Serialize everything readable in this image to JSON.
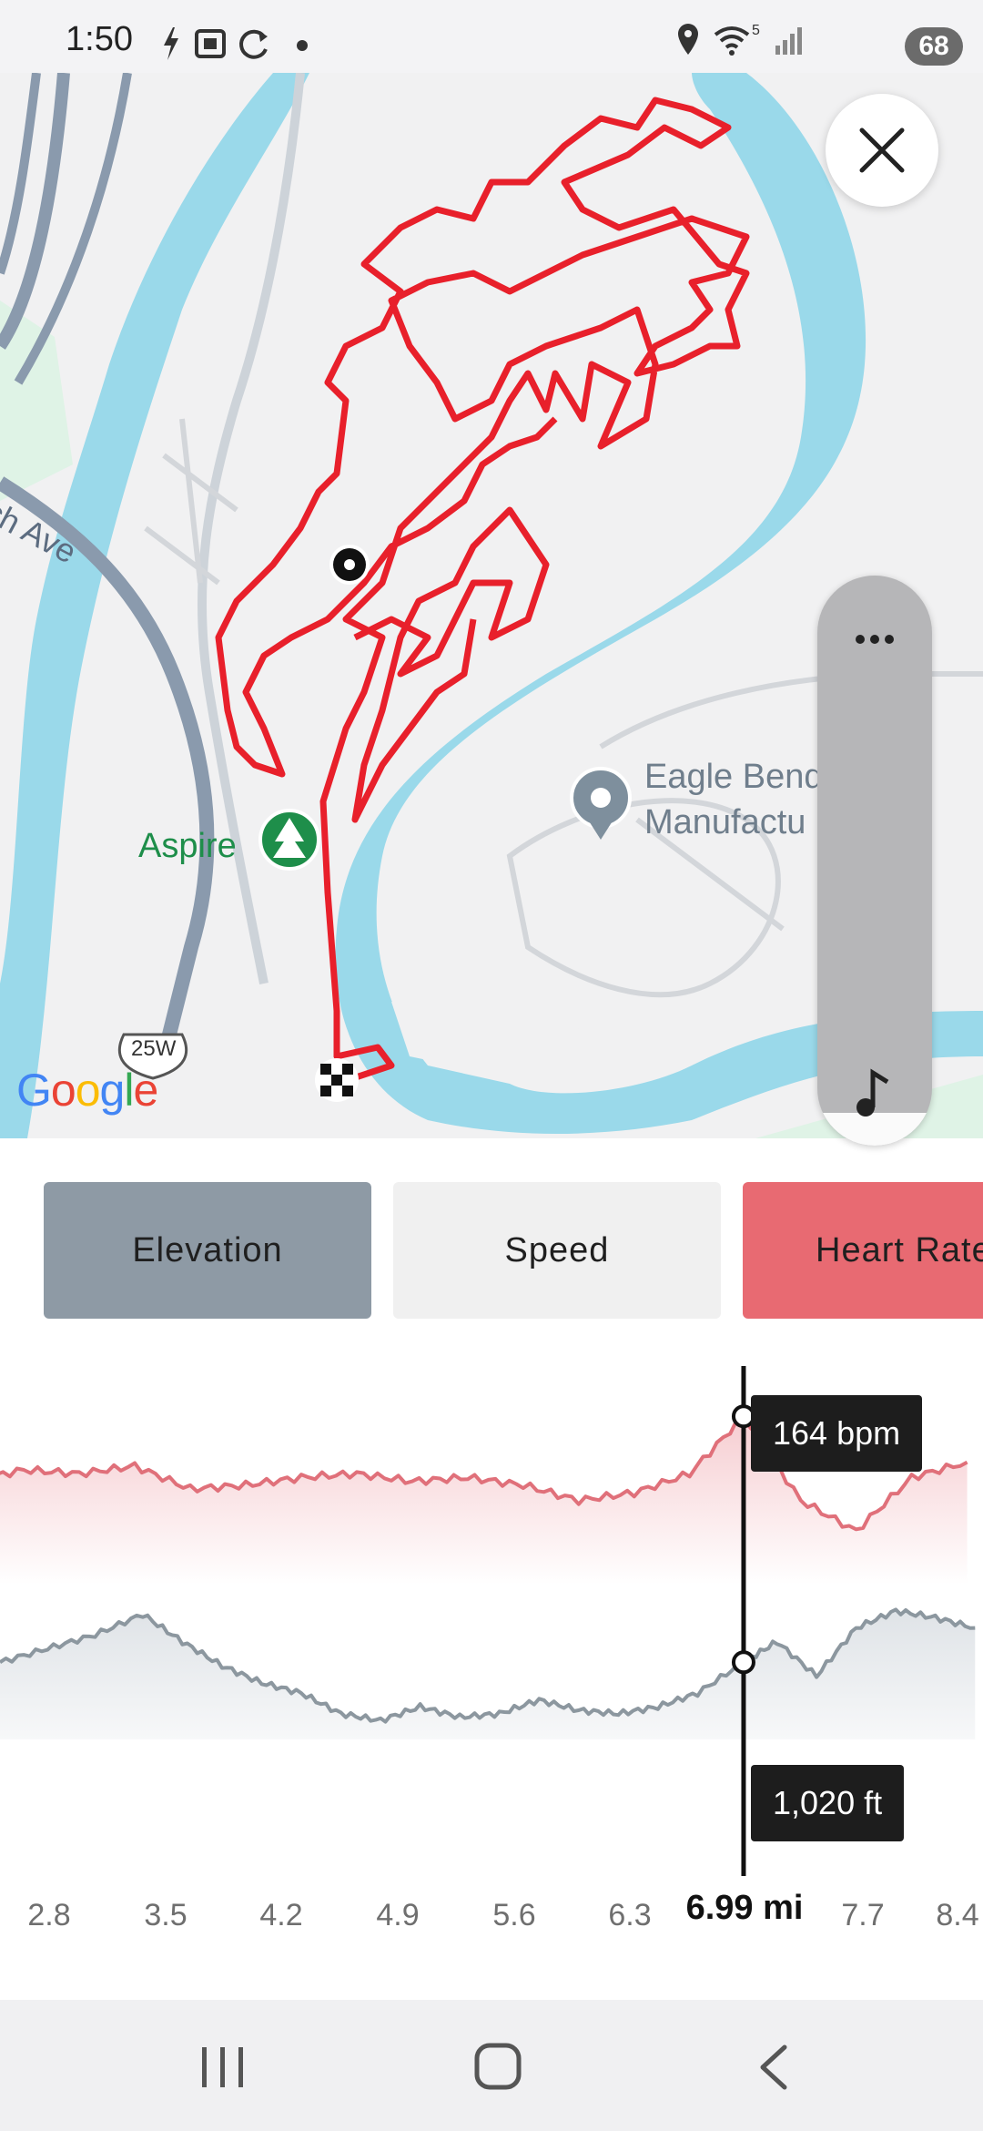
{
  "status_bar": {
    "time": "1:50",
    "battery": "68",
    "left_icons": [
      "bolt-icon",
      "screenshot-icon",
      "sync-icon",
      "dot-icon"
    ],
    "right_icons": [
      "location-icon",
      "wifi-icon",
      "signal-icon",
      "battery-icon"
    ],
    "wifi_label": "5"
  },
  "map": {
    "labels": {
      "street": "ch Ave",
      "park": "Aspire",
      "place_line1": "Eagle Bend",
      "place_line2": "Manufactu",
      "highway": "25W"
    },
    "google": [
      "G",
      "o",
      "o",
      "g",
      "l",
      "e"
    ],
    "google_colors": [
      "#4285F4",
      "#EA4335",
      "#FBBC05",
      "#4285F4",
      "#34A853",
      "#EA4335"
    ],
    "route_color": "#e8202b",
    "water_color": "#9ad9ea",
    "park_color": "#dff3e6"
  },
  "controls": {
    "close_icon": "close-icon",
    "more_icon": "more-icon",
    "music_icon": "music-note-icon"
  },
  "tabs": [
    {
      "label": "Elevation",
      "active": true
    },
    {
      "label": "Speed",
      "active": false
    },
    {
      "label": "Heart Rate",
      "active": false
    }
  ],
  "chart_data": [
    {
      "type": "line",
      "title": "",
      "ylabel": "",
      "xlabel": "",
      "series": [
        {
          "name": "Heart Rate",
          "unit": "bpm"
        }
      ],
      "color": "#e0707a",
      "x": [
        0,
        0.35,
        0.7,
        1.05,
        1.4,
        1.75,
        2.1,
        2.45,
        2.8,
        3.15,
        3.5,
        3.85,
        4.2,
        4.55,
        4.9,
        5.25,
        5.6,
        5.95,
        6.3,
        6.65,
        6.99,
        7.35,
        7.7,
        8.05,
        8.4
      ],
      "y": [
        152,
        145,
        143,
        136,
        139,
        146,
        147,
        150,
        149,
        151,
        145,
        146,
        148,
        149,
        147,
        148,
        146,
        142,
        144,
        149,
        164,
        142,
        134,
        148,
        152
      ],
      "selected": {
        "x": "6.99 mi",
        "label": "164 bpm"
      }
    },
    {
      "type": "area",
      "title": "",
      "ylabel": "",
      "xlabel": "",
      "series": [
        {
          "name": "Elevation",
          "unit": "ft"
        }
      ],
      "color": "#8c979f",
      "x": [
        2.3,
        2.6,
        2.9,
        3.2,
        3.45,
        3.7,
        3.95,
        4.2,
        4.45,
        4.7,
        4.95,
        5.2,
        5.45,
        5.7,
        5.95,
        6.2,
        6.45,
        6.7,
        6.99,
        7.2,
        7.45,
        7.7,
        7.95,
        8.2,
        8.45
      ],
      "y": [
        1020,
        1028,
        1036,
        1048,
        1032,
        1018,
        1008,
        1002,
        990,
        986,
        994,
        988,
        990,
        998,
        992,
        990,
        994,
        1002,
        1020,
        1032,
        1012,
        1040,
        1050,
        1046,
        1040
      ],
      "selected": {
        "x": "6.99 mi",
        "label": "1,020 ft"
      }
    }
  ],
  "x_axis": {
    "ticks": [
      "2.8",
      "3.5",
      "4.2",
      "4.9",
      "5.6",
      "6.3",
      "7.7",
      "8.4"
    ],
    "current": "6.99 mi"
  },
  "readouts": {
    "heart_rate": "164 bpm",
    "elevation": "1,020 ft"
  },
  "nav_bar": {
    "icons": [
      "recents-icon",
      "home-icon",
      "back-icon"
    ]
  }
}
